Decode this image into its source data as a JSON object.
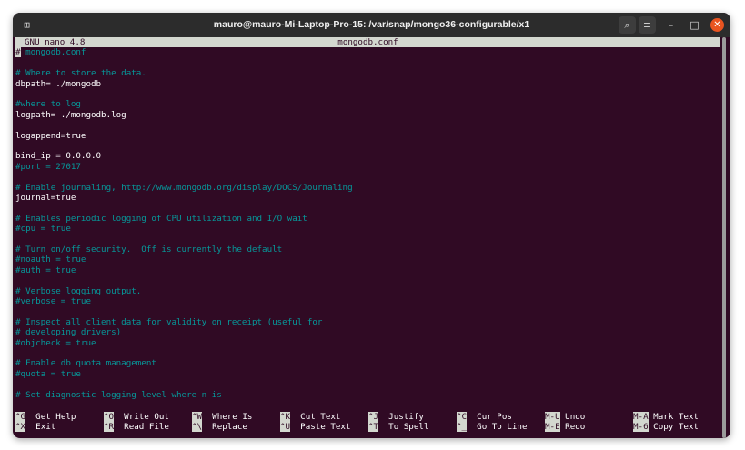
{
  "window": {
    "title": "mauro@mauro-Mi-Laptop-Pro-15: /var/snap/mongo36-configurable/x1",
    "controls": {
      "new_tab": "⊞",
      "search": "⌕",
      "menu": "≡",
      "minimize": "–",
      "maximize": "□",
      "close": "✕"
    }
  },
  "nano": {
    "version": "GNU nano 4.8",
    "filename": "mongodb.conf",
    "cursor_char": "#",
    "first_line_rest": " mongodb.conf",
    "lines": [
      {
        "text": "",
        "kind": "blank"
      },
      {
        "text": "# Where to store the data.",
        "kind": "comment"
      },
      {
        "text": "dbpath= ./mongodb",
        "kind": "code"
      },
      {
        "text": "",
        "kind": "blank"
      },
      {
        "text": "#where to log",
        "kind": "comment"
      },
      {
        "text": "logpath= ./mongodb.log",
        "kind": "code"
      },
      {
        "text": "",
        "kind": "blank"
      },
      {
        "text": "logappend=true",
        "kind": "code"
      },
      {
        "text": "",
        "kind": "blank"
      },
      {
        "text": "bind_ip = 0.0.0.0",
        "kind": "code"
      },
      {
        "text": "#port = 27017",
        "kind": "comment"
      },
      {
        "text": "",
        "kind": "blank"
      },
      {
        "text": "# Enable journaling, http://www.mongodb.org/display/DOCS/Journaling",
        "kind": "comment"
      },
      {
        "text": "journal=true",
        "kind": "code"
      },
      {
        "text": "",
        "kind": "blank"
      },
      {
        "text": "# Enables periodic logging of CPU utilization and I/O wait",
        "kind": "comment"
      },
      {
        "text": "#cpu = true",
        "kind": "comment"
      },
      {
        "text": "",
        "kind": "blank"
      },
      {
        "text": "# Turn on/off security.  Off is currently the default",
        "kind": "comment"
      },
      {
        "text": "#noauth = true",
        "kind": "comment"
      },
      {
        "text": "#auth = true",
        "kind": "comment"
      },
      {
        "text": "",
        "kind": "blank"
      },
      {
        "text": "# Verbose logging output.",
        "kind": "comment"
      },
      {
        "text": "#verbose = true",
        "kind": "comment"
      },
      {
        "text": "",
        "kind": "blank"
      },
      {
        "text": "# Inspect all client data for validity on receipt (useful for",
        "kind": "comment"
      },
      {
        "text": "# developing drivers)",
        "kind": "comment"
      },
      {
        "text": "#objcheck = true",
        "kind": "comment"
      },
      {
        "text": "",
        "kind": "blank"
      },
      {
        "text": "# Enable db quota management",
        "kind": "comment"
      },
      {
        "text": "#quota = true",
        "kind": "comment"
      },
      {
        "text": "",
        "kind": "blank"
      },
      {
        "text": "# Set diagnostic logging level where n is",
        "kind": "comment"
      }
    ],
    "shortcuts_row1": [
      {
        "key": "^G",
        "label": "Get Help"
      },
      {
        "key": "^O",
        "label": "Write Out"
      },
      {
        "key": "^W",
        "label": "Where Is"
      },
      {
        "key": "^K",
        "label": "Cut Text"
      },
      {
        "key": "^J",
        "label": "Justify"
      },
      {
        "key": "^C",
        "label": "Cur Pos"
      },
      {
        "key": "M-U",
        "label": "Undo"
      },
      {
        "key": "M-A",
        "label": "Mark Text"
      }
    ],
    "shortcuts_row2": [
      {
        "key": "^X",
        "label": "Exit"
      },
      {
        "key": "^R",
        "label": "Read File"
      },
      {
        "key": "^\\",
        "label": "Replace"
      },
      {
        "key": "^U",
        "label": "Paste Text"
      },
      {
        "key": "^T",
        "label": "To Spell"
      },
      {
        "key": "^_",
        "label": "Go To Line"
      },
      {
        "key": "M-E",
        "label": "Redo"
      },
      {
        "key": "M-6",
        "label": "Copy Text"
      }
    ]
  },
  "colors": {
    "terminal_bg": "#300a24",
    "comment": "#06989a",
    "header_bg": "#d3d7cf",
    "close_button": "#e95420"
  }
}
